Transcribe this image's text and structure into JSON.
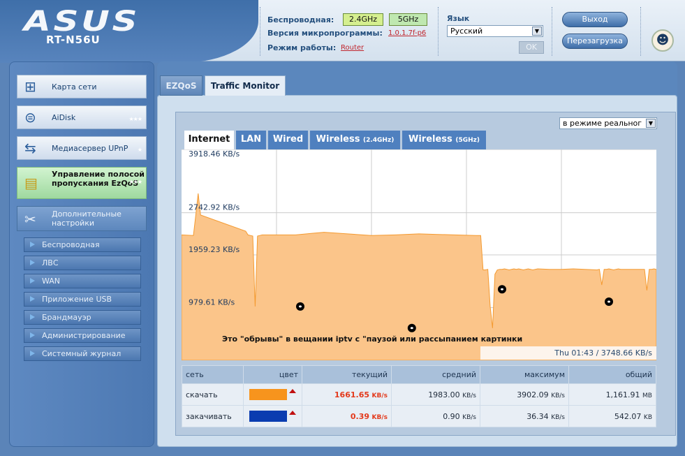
{
  "header": {
    "brand": "ASUS",
    "model": "RT-N56U",
    "wireless_label": "Беспроводная:",
    "band_24": "2.4GHz",
    "band_5": "5GHz",
    "firmware_label": "Версия микропрограммы:",
    "firmware_value": "1.0.1.7f-p6",
    "mode_label": "Режим работы:",
    "mode_value": "Router",
    "language_label": "Язык",
    "language_value": "Русский",
    "ok_label": "OK",
    "logout_label": "Выход",
    "reboot_label": "Перезагрузка"
  },
  "sidebar": {
    "items": [
      {
        "label": "Карта сети",
        "icon": "network-map-icon"
      },
      {
        "label": "AiDisk",
        "icon": "disk-icon"
      },
      {
        "label": "Медиасервер UPnP",
        "icon": "media-server-icon"
      },
      {
        "label": "Управление полосой пропускания EzQoS",
        "icon": "bandwidth-icon"
      },
      {
        "label": "Дополнительные настройки",
        "icon": "tools-icon"
      }
    ],
    "sub_items": [
      "Беспроводная",
      "ЛВС",
      "WAN",
      "Приложение USB",
      "Брандмауэр",
      "Администрирование",
      "Системный журнал"
    ]
  },
  "tabs": {
    "ezqos": "EZQoS",
    "traffic": "Traffic Monitor"
  },
  "monitor": {
    "mode_select": "в режиме реальног",
    "chart_tabs": [
      {
        "label": "Internet",
        "suffix": ""
      },
      {
        "label": "LAN",
        "suffix": ""
      },
      {
        "label": "Wired",
        "suffix": ""
      },
      {
        "label": "Wireless",
        "suffix": "(2.4GHz)"
      },
      {
        "label": "Wireless",
        "suffix": "(5GHz)"
      }
    ],
    "annotation": "Это \"обрывы\" в вещании iptv с \"паузой или рассыпанием картинки",
    "timestamp": "Thu 01:43 / 3748.66 KB/s"
  },
  "chart_data": {
    "type": "area",
    "ytick_labels": [
      "3918.46 KB/s",
      "2742.92 KB/s",
      "1959.23 KB/s",
      "979.61 KB/s"
    ],
    "ylim": [
      0,
      3918.46
    ],
    "series": [
      {
        "name": "скачать",
        "color": "#fbc58a",
        "x": [
          0,
          5,
          6,
          7,
          8,
          27,
          28,
          29,
          30,
          31,
          32,
          33,
          34,
          35,
          48,
          55,
          60,
          80,
          90,
          100,
          108,
          115,
          124,
          126,
          127,
          128,
          129,
          130,
          131,
          132,
          133,
          134,
          135,
          136,
          137,
          138,
          139,
          140,
          141,
          142,
          143,
          144,
          145,
          146,
          147,
          148,
          149,
          150,
          155,
          160,
          165,
          170,
          175,
          176,
          177,
          178,
          179,
          180,
          181,
          182,
          183,
          184,
          185,
          190,
          195,
          196,
          197,
          198,
          199,
          200
        ],
        "y": [
          2330,
          2320,
          2700,
          3100,
          2700,
          2400,
          2330,
          2320,
          2310,
          1000,
          2310,
          2320,
          2330,
          2330,
          2330,
          2360,
          2380,
          2320,
          2330,
          2350,
          2340,
          2330,
          2320,
          2320,
          1680,
          1680,
          1690,
          1000,
          600,
          1600,
          1680,
          1690,
          1690,
          1700,
          1690,
          1680,
          1690,
          1700,
          1690,
          1700,
          1690,
          1680,
          1690,
          1700,
          1690,
          1680,
          1690,
          1700,
          1690,
          1690,
          1700,
          1690,
          1680,
          1690,
          1400,
          1690,
          1690,
          1700,
          1690,
          1680,
          1690,
          1700,
          1690,
          1690,
          1690,
          1300,
          1690,
          1690,
          1700,
          1690
        ]
      }
    ],
    "markers": [
      [
        50,
        1000
      ],
      [
        97,
        600
      ],
      [
        135,
        1320
      ],
      [
        180,
        1090
      ]
    ]
  },
  "stats": {
    "headers": [
      "сеть",
      "цвет",
      "текущий",
      "средний",
      "максимум",
      "общий"
    ],
    "rows": [
      {
        "label": "скачать",
        "color": "#f7941d",
        "current": "1661.65",
        "average": "1983.00",
        "max": "3902.09",
        "total": "1,161.91",
        "total_unit": "MB"
      },
      {
        "label": "закачивать",
        "color": "#0a3cb0",
        "current": "0.39",
        "average": "0.90",
        "max": "36.34",
        "total": "542.07",
        "total_unit": "KB"
      }
    ],
    "rate_unit": "KB/s"
  }
}
